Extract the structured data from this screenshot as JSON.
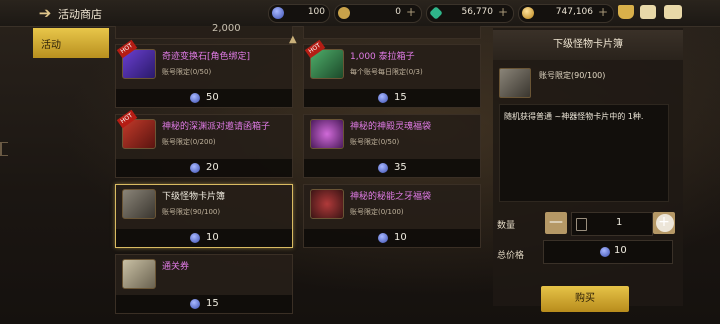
{
  "header": {
    "title": "活动商店",
    "currencies": [
      {
        "icon": "blue-coin-icon",
        "value": "100",
        "color": "#5a6fd6"
      },
      {
        "icon": "gold-c-coin-icon",
        "value": "0",
        "color": "#c9a24a"
      },
      {
        "icon": "green-gem-icon",
        "value": "56,770",
        "color": "#2fb58a"
      },
      {
        "icon": "gold-coin-icon",
        "value": "747,106",
        "color": "#d9a43a"
      }
    ]
  },
  "sidebar": {
    "active_tab": "活动"
  },
  "top_partials": [
    {
      "price": "2,000"
    },
    {
      "price": ""
    }
  ],
  "items": [
    {
      "name": "奇迹变换石[角色绑定]",
      "limit": "账号限定(0/50)",
      "price": "50",
      "hot": true,
      "name_color": "#e07be6"
    },
    {
      "name": "1,000 泰拉箱子",
      "limit": "每个账号每日限定(0/3)",
      "price": "15",
      "hot": true,
      "name_color": "#e07be6"
    },
    {
      "name": "神秘的深渊派对邀请函箱子",
      "limit": "账号限定(0/200)",
      "price": "20",
      "hot": true,
      "name_color": "#e07be6"
    },
    {
      "name": "神秘的神殿灵魂福袋",
      "limit": "账号限定(0/50)",
      "price": "35",
      "hot": false,
      "name_color": "#e07be6"
    },
    {
      "name": "下级怪物卡片簿",
      "limit": "账号限定(90/100)",
      "price": "10",
      "hot": false,
      "name_color": "#f0ece0",
      "selected": true
    },
    {
      "name": "神秘的秘能之牙福袋",
      "limit": "账号限定(0/100)",
      "price": "10",
      "hot": false,
      "name_color": "#e07be6"
    },
    {
      "name": "通关券",
      "limit": "",
      "price": "15",
      "hot": false,
      "name_color": "#e07be6"
    }
  ],
  "hot_label": "HOT",
  "detail": {
    "title": "下级怪物卡片簿",
    "limit": "账号限定(90/100)",
    "description": "随机获得普通 ~神器怪物卡片中的 1种.",
    "quantity_label": "数量",
    "minus": "—",
    "quantity": "1",
    "plus": "+",
    "total_label": "总价格",
    "total": "10",
    "buy_label": "购买"
  }
}
